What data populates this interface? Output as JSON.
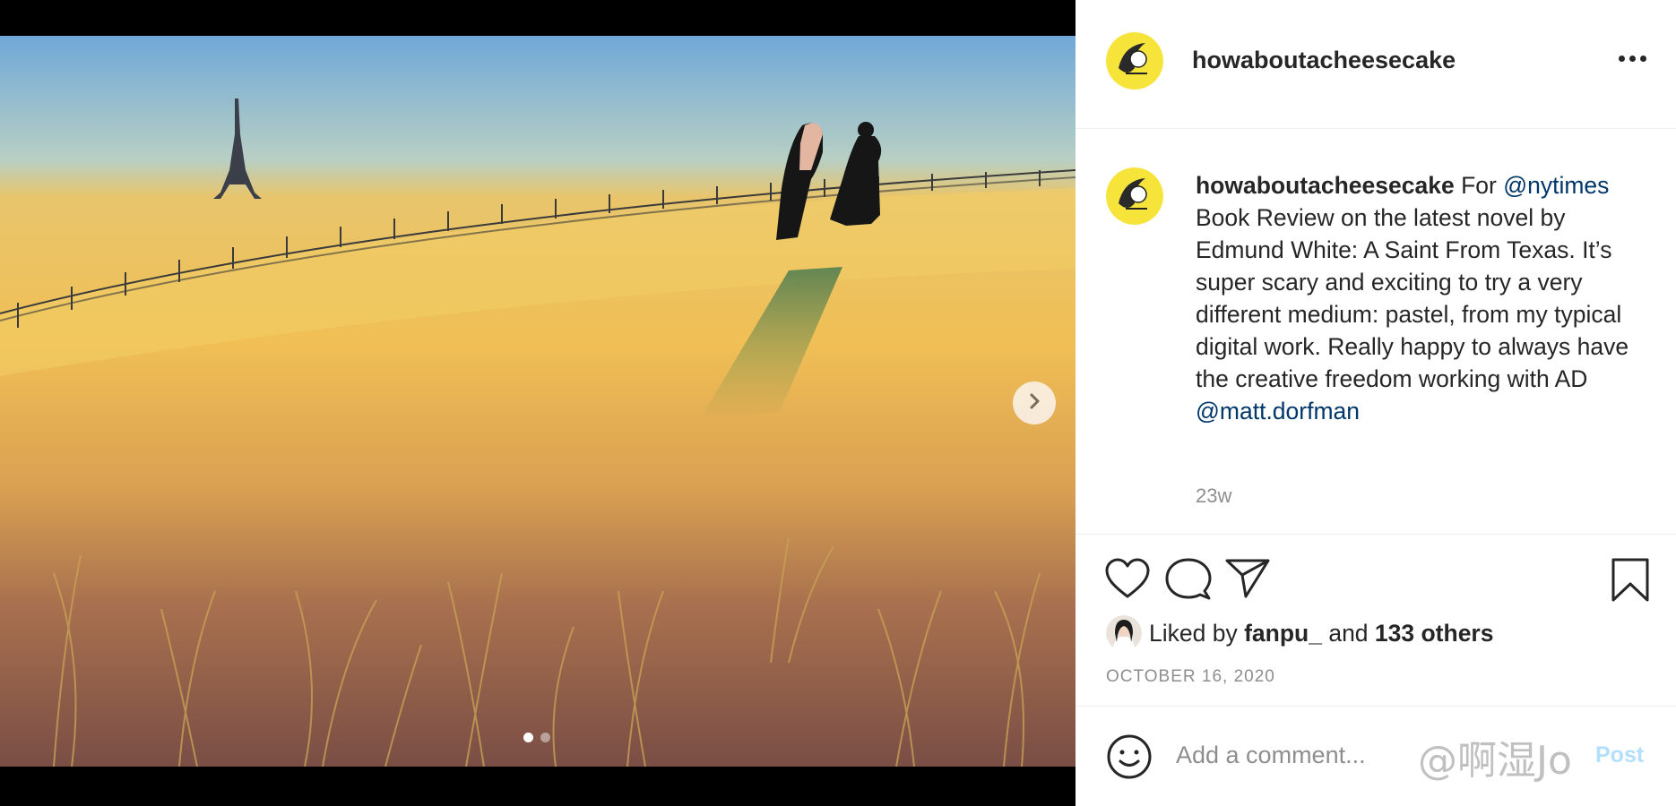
{
  "post": {
    "username": "howaboutacheesecake",
    "caption_parts": {
      "p1": "For ",
      "mention1": "@nytimes",
      "p2": " Book Review on the latest novel by Edmund White: A Saint From Texas. It’s super scary and exciting to try a very different medium: pastel, from my typical digital work. Really happy to always have the creative freedom working with AD ",
      "mention2": "@matt.dorfman"
    },
    "time_ago": "23w",
    "likes": {
      "prefix": "Liked by ",
      "user": "fanpu_",
      "mid": " and ",
      "others": "133 others"
    },
    "date": "OCTOBER 16, 2020"
  },
  "comment": {
    "placeholder": "Add a comment...",
    "post_label": "Post"
  },
  "watermark": "@啊湿Jo",
  "carousel": {
    "count": 2,
    "active": 1
  },
  "icons": {
    "more": "more-options-icon",
    "next": "chevron-right-icon",
    "like": "heart-icon",
    "comment": "comment-bubble-icon",
    "share": "paper-plane-icon",
    "save": "bookmark-icon",
    "emoji": "smiley-icon"
  },
  "colors": {
    "mention": "#00376b",
    "text": "#262626",
    "muted": "#8e8e8e",
    "post_button": "#b2dffc"
  }
}
